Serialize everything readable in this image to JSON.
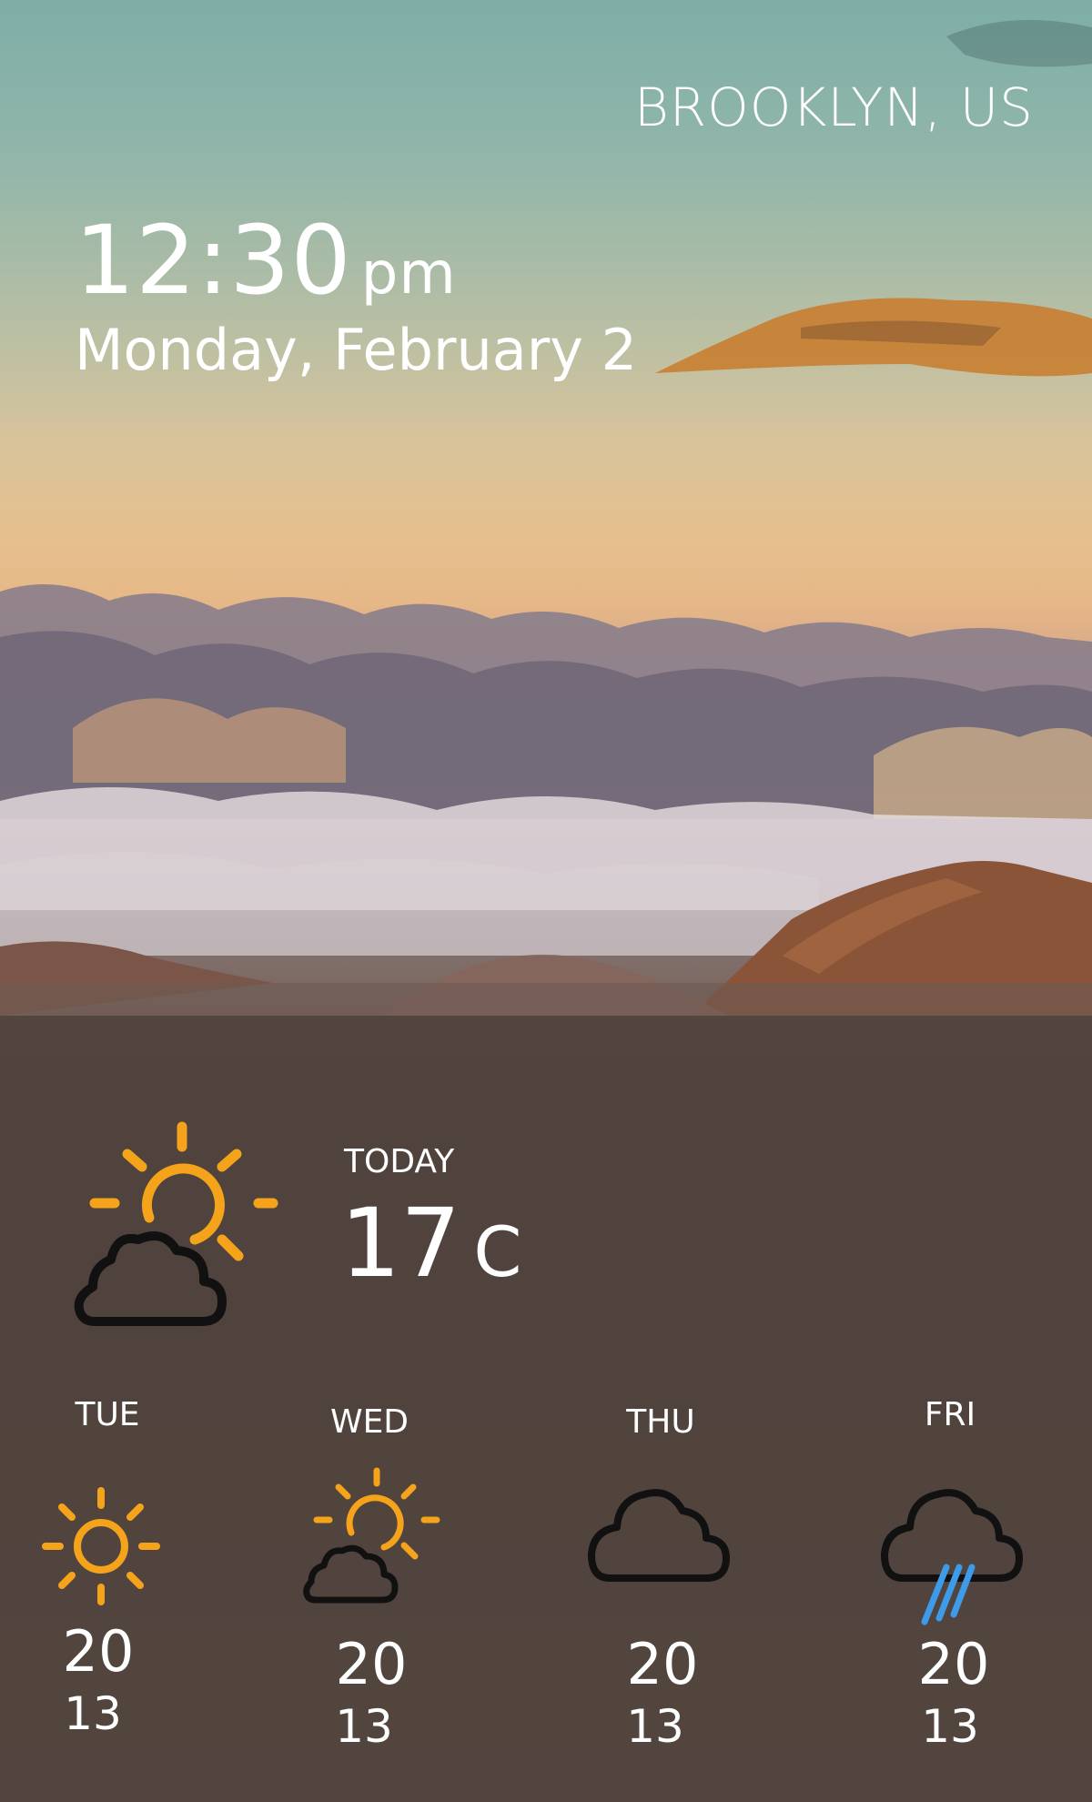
{
  "header": {
    "location": "BROOKLYN, US"
  },
  "clock": {
    "time": "12:30",
    "ampm": "pm",
    "date": "Monday, February 2"
  },
  "today": {
    "label": "TODAY",
    "temp": "17",
    "unit": "C",
    "icon": "partly-cloudy-icon"
  },
  "forecast": [
    {
      "day": "TUE",
      "high": "20",
      "low": "13",
      "icon": "sun-icon"
    },
    {
      "day": "WED",
      "high": "20",
      "low": "13",
      "icon": "partly-cloudy-icon"
    },
    {
      "day": "THU",
      "high": "20",
      "low": "13",
      "icon": "cloud-icon"
    },
    {
      "day": "FRI",
      "high": "20",
      "low": "13",
      "icon": "rain-icon"
    }
  ],
  "colors": {
    "sun": "#f5a31a",
    "rain": "#3d9be9",
    "cloud_outline": "#111111",
    "text": "#ffffff"
  }
}
